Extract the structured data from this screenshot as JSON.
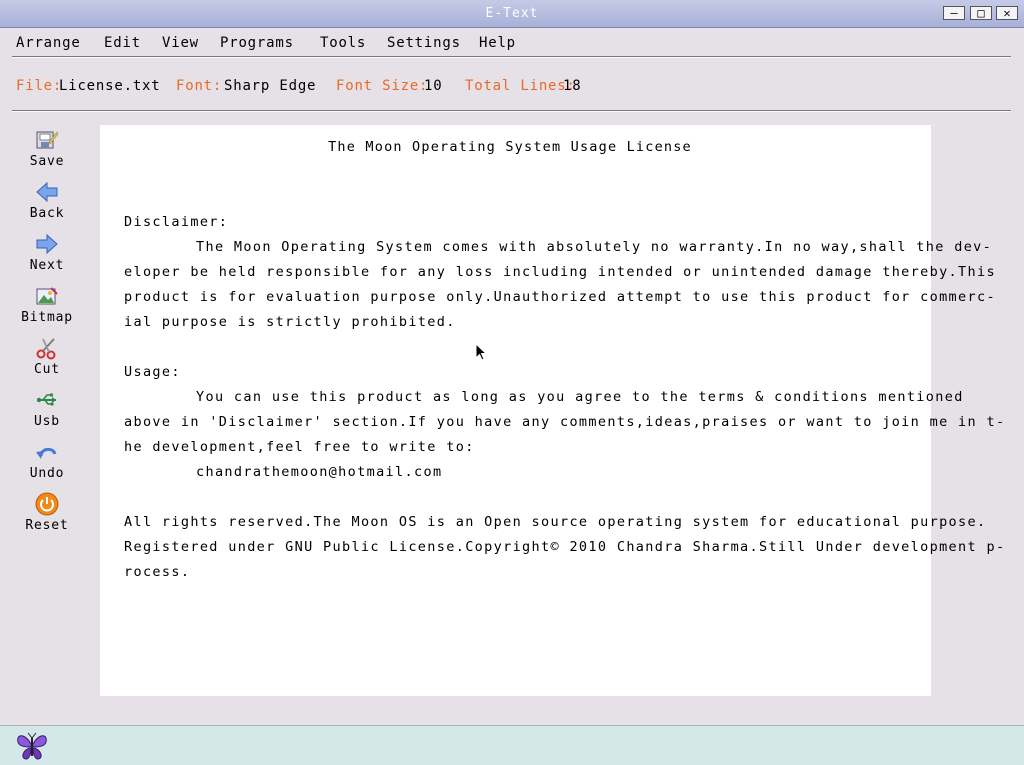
{
  "window": {
    "title": "E-Text"
  },
  "menu": [
    "Arrange",
    "Edit",
    "View",
    "Programs",
    "Tools",
    "Settings",
    "Help"
  ],
  "info": {
    "file_label": "File:",
    "file_value": "License.txt",
    "font_label": "Font:",
    "font_value": "Sharp Edge",
    "size_label": "Font Size:",
    "size_value": "10",
    "lines_label": "Total Lines:",
    "lines_value": "18"
  },
  "tools": [
    "Save",
    "Back",
    "Next",
    "Bitmap",
    "Cut",
    "Usb",
    "Undo",
    "Reset"
  ],
  "document": {
    "heading": "The Moon Operating System Usage License",
    "lines": [
      "Disclaimer:",
      "The Moon Operating System comes with absolutely no warranty.In no way,shall the dev-",
      "eloper be held responsible for any loss including intended or unintended damage thereby.This",
      "product is for evaluation purpose only.Unauthorized attempt to use this product for commerc-",
      "ial purpose is strictly prohibited.",
      "Usage:",
      "You can use this product as long as you agree to the terms & conditions mentioned",
      "above in 'Disclaimer' section.If you have any comments,ideas,praises or want to join me in t-",
      "he development,feel free to write to:",
      "chandrathemoon@hotmail.com",
      "All rights reserved.The Moon OS is an Open source operating system for educational purpose.",
      "Registered under GNU Public License.Copyright© 2010 Chandra Sharma.Still Under development p-",
      "rocess."
    ]
  },
  "colors": {
    "label_accent": "#e86a2a",
    "titlebar": "#b0b8de",
    "taskbar": "#d4e8ea"
  }
}
